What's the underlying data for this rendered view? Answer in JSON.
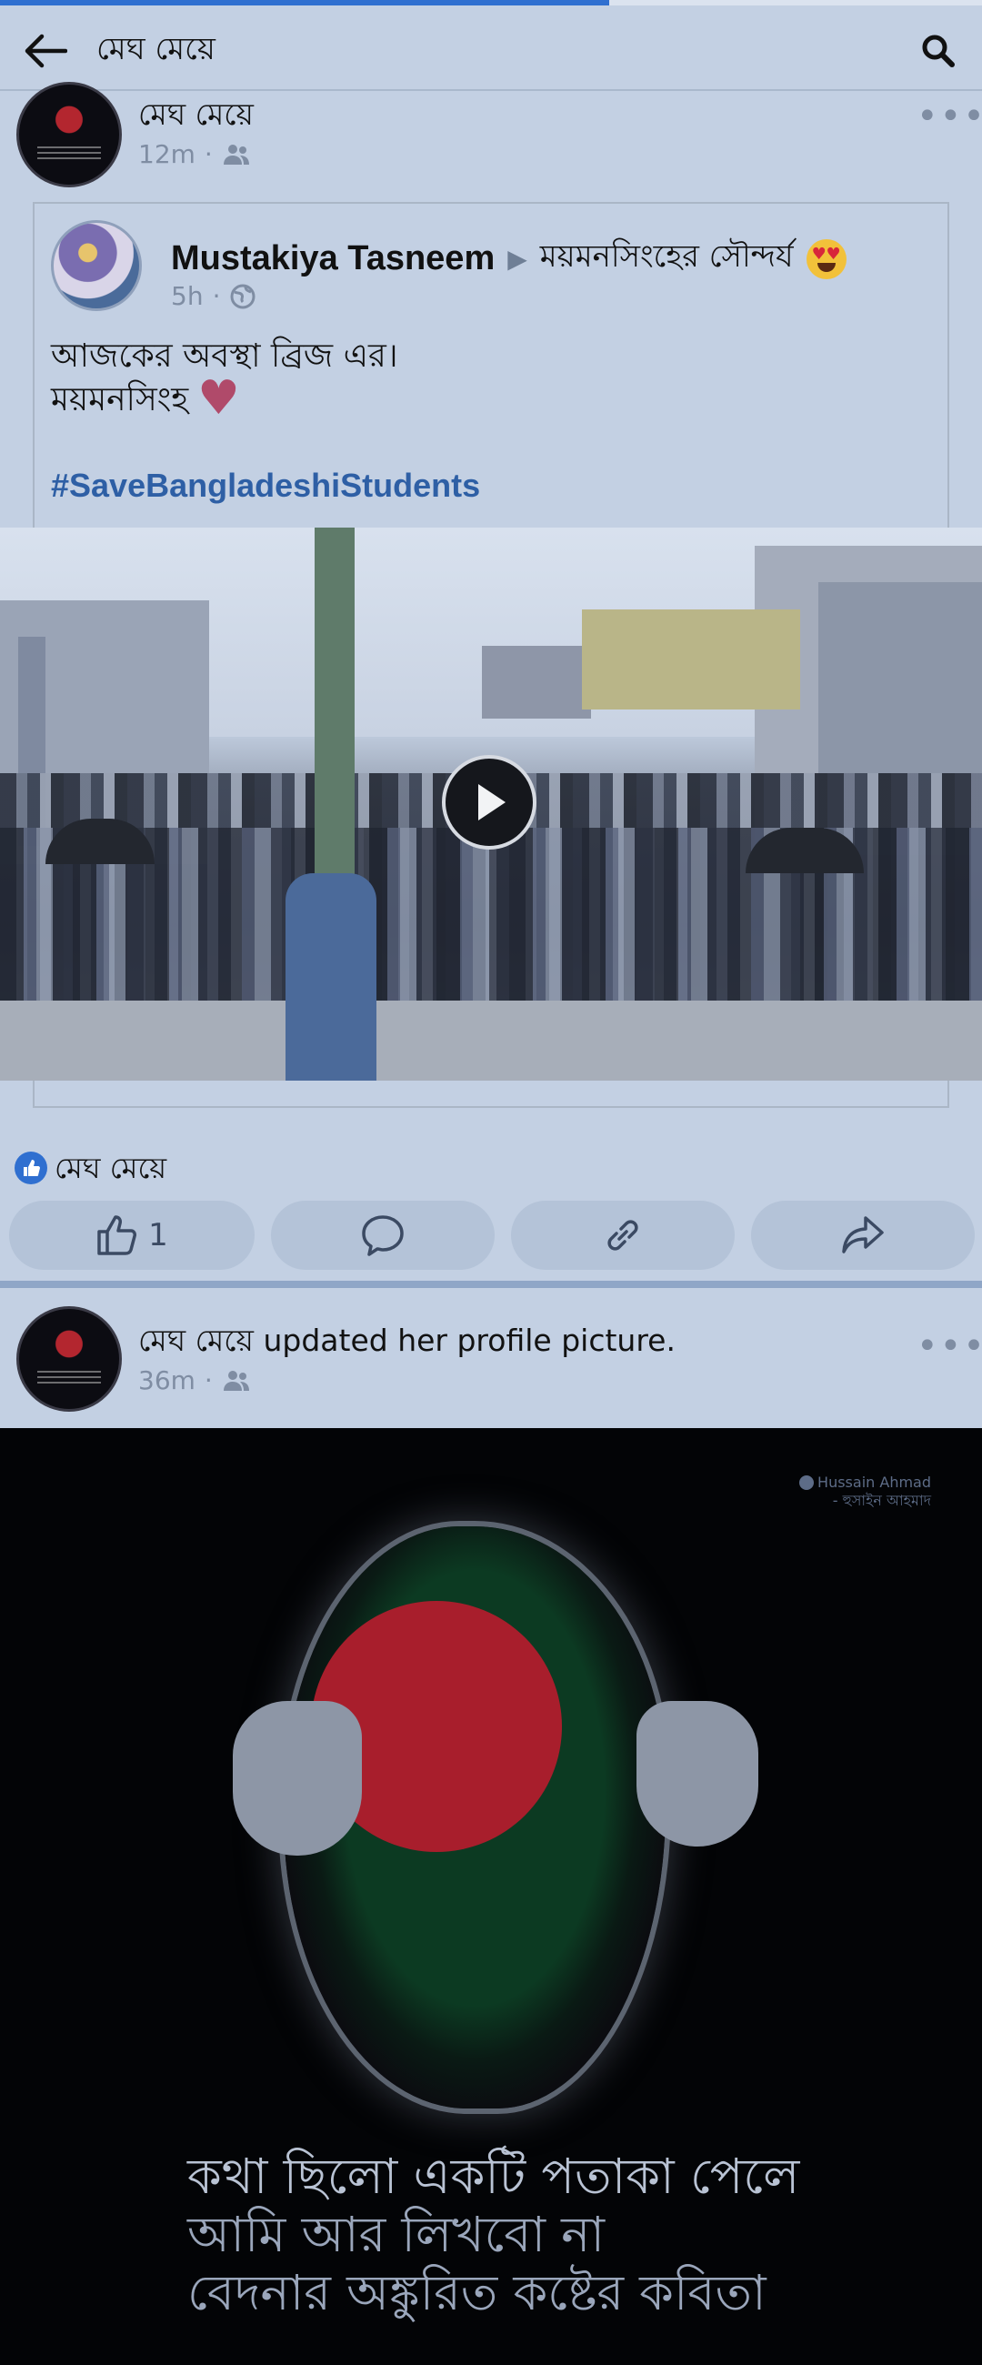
{
  "loading_progress": 0.62,
  "header": {
    "title": "মেঘ মেয়ে",
    "back_icon": "arrow-left-icon",
    "search_icon": "search-icon"
  },
  "post1": {
    "author": "মেঘ মেয়ে",
    "time": "12m",
    "privacy_icon": "friends-icon",
    "more_icon": "more-dots-icon",
    "shared": {
      "author": "Mustakiya Tasneem",
      "group": "ময়মনসিংহের সৌন্দর্য",
      "emoji_icon": "heart-eyes-emoji-icon",
      "time": "5h",
      "privacy_icon": "globe-icon",
      "text_line1": "আজকের অবস্থা ব্রিজ এর।",
      "text_line2": "ময়মনসিংহ",
      "heart_icon": "heart-emoji-icon",
      "hashtag": "#SaveBangladeshiStudents",
      "video_icon": "play-icon"
    },
    "like_summary": "মেঘ মেয়ে",
    "actions": {
      "like_count": "1",
      "like_icon": "thumbs-up-icon",
      "comment_icon": "comment-icon",
      "link_icon": "link-icon",
      "share_icon": "share-icon"
    }
  },
  "post2": {
    "author_line": "মেঘ মেয়ে updated her profile picture.",
    "time": "36m",
    "privacy_icon": "friends-icon",
    "more_icon": "more-dots-icon",
    "image": {
      "credit_line1": "Hussain Ahmad",
      "credit_line2": "- হুসাইন আহমাদ",
      "poem_line1": "কথা ছিলো একটি পতাকা পেলে",
      "poem_line2": "আমি আর লিখবো না",
      "poem_line3": "বেদনার অঙ্কুরিত কষ্টের কবিতা"
    }
  },
  "colors": {
    "accent": "#2f6fd0",
    "hashtag": "#2e5fa5",
    "background": "#c3d0e3"
  }
}
